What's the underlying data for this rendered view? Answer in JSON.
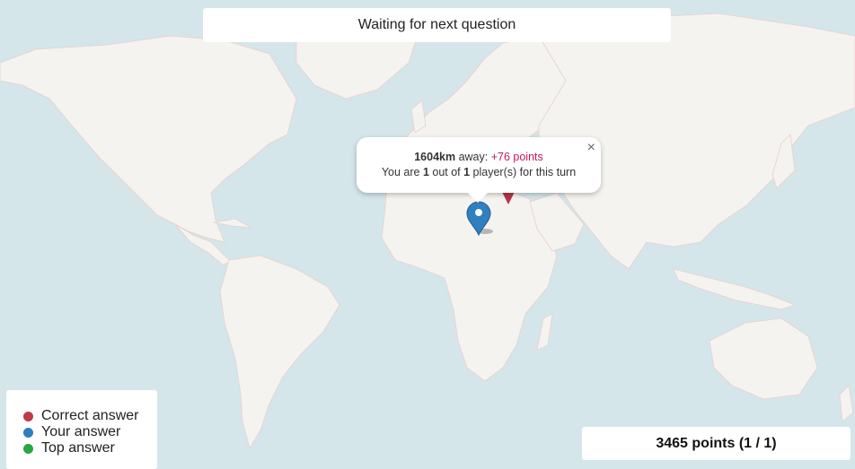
{
  "status": {
    "text": "Waiting for next question"
  },
  "popup": {
    "distance": "1604km",
    "away": " away: ",
    "points": "+76 points",
    "rank_prefix": "You are ",
    "rank": "1",
    "rank_mid": " out of ",
    "total": "1",
    "rank_suffix": " player(s) for this turn",
    "close": "×"
  },
  "legend": {
    "items": [
      {
        "label": "Correct answer",
        "color": "#c0394b"
      },
      {
        "label": "Your answer",
        "color": "#2f7fc1"
      },
      {
        "label": "Top answer",
        "color": "#28a745"
      }
    ]
  },
  "score": {
    "text": "3465 points (1 / 1)"
  },
  "colors": {
    "water": "#d4e6ea",
    "land": "#f5f3ef",
    "correct_marker": "#b3344a",
    "your_marker": "#2f7fc1"
  }
}
